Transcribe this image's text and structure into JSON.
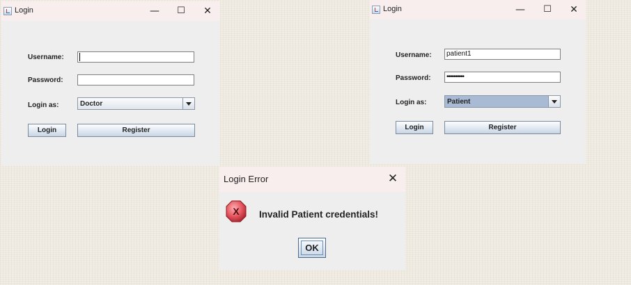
{
  "windows": [
    {
      "title": "Login",
      "controls": {
        "minimize": "—",
        "maximize": "☐",
        "close": "✕"
      },
      "username_label": "Username:",
      "username_value": "",
      "password_label": "Password:",
      "password_value": "",
      "login_as_label": "Login as:",
      "login_as_value": "Doctor",
      "login_button": "Login",
      "register_button": "Register"
    },
    {
      "title": "Login",
      "controls": {
        "minimize": "—",
        "maximize": "☐",
        "close": "✕"
      },
      "username_label": "Username:",
      "username_value": "patient1",
      "password_label": "Password:",
      "password_value": "••••••••••",
      "login_as_label": "Login as:",
      "login_as_value": "Patient",
      "login_button": "Login",
      "register_button": "Register"
    }
  ],
  "dialog": {
    "title": "Login Error",
    "close": "✕",
    "message": "Invalid Patient credentials!",
    "error_icon_glyph": "X",
    "ok_button": "OK"
  },
  "colors": {
    "combo_selected": "#a9bbd4",
    "error_icon": "#d94b55"
  }
}
